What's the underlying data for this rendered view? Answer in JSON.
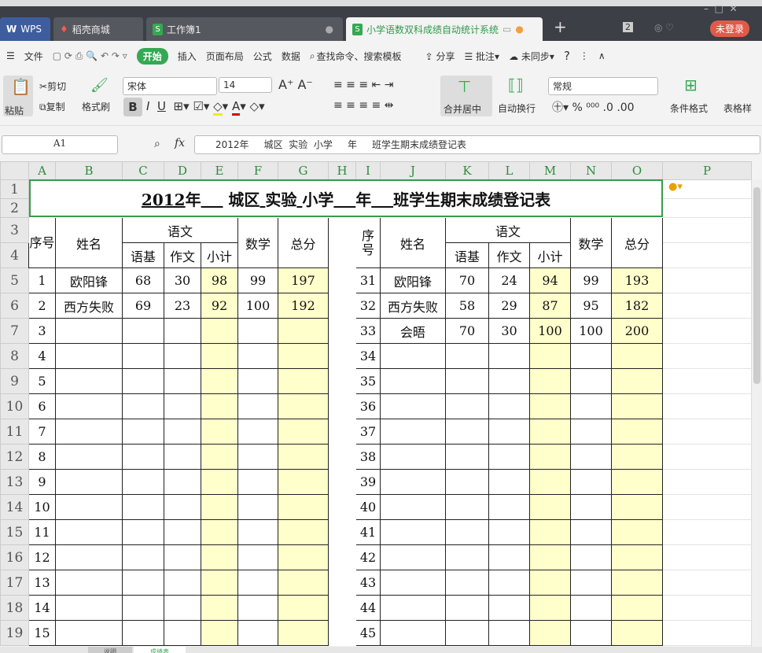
{
  "app": {
    "wps": "WPS",
    "tabs": [
      {
        "label": "稻壳商城"
      },
      {
        "label": "工作簿1"
      },
      {
        "label": "小学语数双科成绩自动统计系统"
      }
    ],
    "window_count": "2",
    "login": "未登录"
  },
  "menu": {
    "file": "文件",
    "items": [
      "开始",
      "插入",
      "页面布局",
      "公式",
      "数据"
    ],
    "search": "查找命令、搜索模板",
    "share": "分享",
    "comment": "批注",
    "sync": "未同步",
    "help": "?"
  },
  "ribbon": {
    "paste": "粘贴",
    "cut": "剪切",
    "copy": "复制",
    "format_painter": "格式刷",
    "font": "宋体",
    "size": "14",
    "merge": "合并居中",
    "wrap": "自动换行",
    "number_format": "常规",
    "cond_format": "条件格式",
    "table_style": "表格样"
  },
  "formula": {
    "cell": "A1",
    "fx": "fx",
    "value": "2012年     城区  实验  小学     年     班学生期末成绩登记表"
  },
  "columns": [
    "A",
    "B",
    "C",
    "D",
    "E",
    "F",
    "G",
    "H",
    "I",
    "J",
    "K",
    "L",
    "M",
    "N",
    "O",
    "P"
  ],
  "title_parts": [
    {
      "t": "2012",
      "u": true
    },
    {
      "t": "年",
      "u": false
    },
    {
      "t": "    ",
      "u": true
    },
    {
      "t": " 城区",
      "u": false
    },
    {
      "t": " ",
      "u": true
    },
    {
      "t": "实验",
      "u": false
    },
    {
      "t": " ",
      "u": true
    },
    {
      "t": "小学",
      "u": false
    },
    {
      "t": "    ",
      "u": true
    },
    {
      "t": "年",
      "u": false
    },
    {
      "t": "    ",
      "u": true
    },
    {
      "t": "班学生期末成绩登记表",
      "u": false
    }
  ],
  "headers": {
    "seq": "序号",
    "name": "姓名",
    "chinese": "语文",
    "basic": "语基",
    "essay": "作文",
    "subtotal": "小计",
    "math": "数学",
    "total": "总分"
  },
  "left_rows": [
    [
      "1",
      "欧阳锋",
      "68",
      "30",
      "98",
      "99",
      "197"
    ],
    [
      "2",
      "西方失败",
      "69",
      "23",
      "92",
      "100",
      "192"
    ],
    [
      "3",
      "",
      "",
      "",
      "",
      "",
      ""
    ],
    [
      "4"
    ],
    [
      "5"
    ],
    [
      "6"
    ],
    [
      "7"
    ],
    [
      "8"
    ],
    [
      "9"
    ],
    [
      "10"
    ],
    [
      "11"
    ],
    [
      "12"
    ],
    [
      "13"
    ],
    [
      "14"
    ],
    [
      "15"
    ]
  ],
  "right_rows": [
    [
      "31",
      "欧阳锋",
      "70",
      "24",
      "94",
      "99",
      "193"
    ],
    [
      "32",
      "西方失败",
      "58",
      "29",
      "87",
      "95",
      "182"
    ],
    [
      "33",
      "会晤",
      "70",
      "30",
      "100",
      "100",
      "200"
    ],
    [
      "34"
    ],
    [
      "35"
    ],
    [
      "36"
    ],
    [
      "37"
    ],
    [
      "38"
    ],
    [
      "39"
    ],
    [
      "40"
    ],
    [
      "41"
    ],
    [
      "42"
    ],
    [
      "43"
    ],
    [
      "44"
    ],
    [
      "45"
    ]
  ],
  "sheets": [
    "说明",
    "成绩表"
  ],
  "colors": {
    "accent": "#35a853",
    "highlight": "#ffffcc"
  }
}
